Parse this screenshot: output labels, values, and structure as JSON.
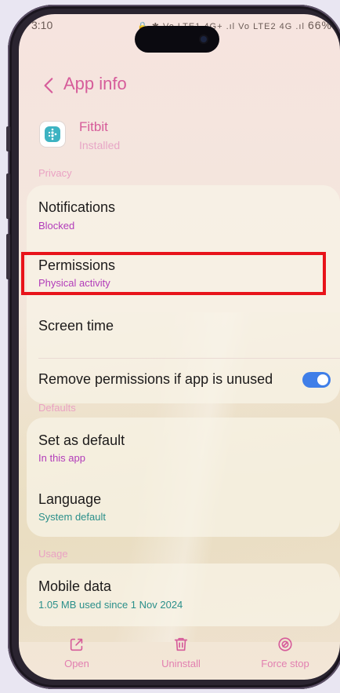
{
  "statusbar": {
    "time": "3:10",
    "icons": "🔒 ✱ Vo LTE1 4G+ .ıl Vo LTE2 4G .ıl",
    "battery": "66%"
  },
  "header": {
    "title": "App info",
    "back_icon": "chevron-left-icon"
  },
  "app": {
    "name": "Fitbit",
    "status": "Installed"
  },
  "sections": {
    "privacy": "Privacy",
    "defaults": "Defaults",
    "usage": "Usage"
  },
  "privacy_items": {
    "notifications": {
      "title": "Notifications",
      "sub": "Blocked"
    },
    "permissions": {
      "title": "Permissions",
      "sub": "Physical activity"
    },
    "screen_time": {
      "title": "Screen time"
    },
    "remove_permissions": {
      "title": "Remove permissions if app is unused",
      "toggle_on": true
    }
  },
  "defaults_items": {
    "set_default": {
      "title": "Set as default",
      "sub": "In this app"
    },
    "language": {
      "title": "Language",
      "sub": "System default"
    }
  },
  "usage_items": {
    "mobile_data": {
      "title": "Mobile data",
      "sub": "1.05 MB used since 1 Nov 2024"
    }
  },
  "bottom_bar": {
    "open": "Open",
    "uninstall": "Uninstall",
    "force_stop": "Force stop"
  },
  "colors": {
    "accent": "#d65c9a",
    "subtitle": "#b23cba",
    "teal": "#2a8f8a",
    "toggle": "#3f7ee8",
    "highlight": "#e8131a"
  }
}
